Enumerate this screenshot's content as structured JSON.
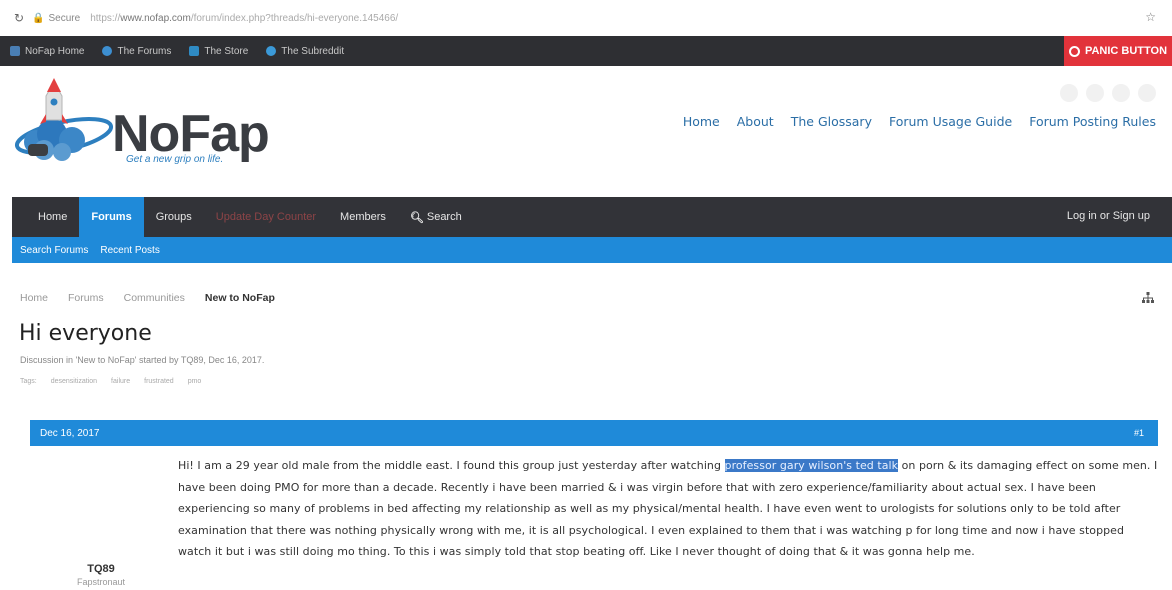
{
  "browser": {
    "secure_label": "Secure",
    "url_prefix": "https://",
    "url_domain": "www.nofap.com",
    "url_path": "/forum/index.php?threads/hi-everyone.145466/"
  },
  "topbar": {
    "links": [
      "NoFap Home",
      "The Forums",
      "The Store",
      "The Subreddit"
    ],
    "panic_label": "PANIC BUTTON"
  },
  "logo": {
    "text": "NoFap",
    "tagline": "Get a new grip on life."
  },
  "header_nav": [
    "Home",
    "About",
    "The Glossary",
    "Forum Usage Guide",
    "Forum Posting Rules"
  ],
  "main_nav": {
    "tabs": [
      "Home",
      "Forums",
      "Groups",
      "Update Day Counter",
      "Members",
      "Search"
    ],
    "login": "Log in or Sign up"
  },
  "sub_nav": [
    "Search Forums",
    "Recent Posts"
  ],
  "breadcrumb": [
    "Home",
    "Forums",
    "Communities",
    "New to NoFap"
  ],
  "thread": {
    "title": "Hi everyone",
    "meta": "Discussion in 'New to NoFap' started by TQ89, Dec 16, 2017.",
    "tags_label": "Tags:",
    "tags": [
      "desensitization",
      "failure",
      "frustrated",
      "pmo"
    ]
  },
  "post": {
    "date": "Dec 16, 2017",
    "number": "#1",
    "text_before": "Hi! I am a 29 year old male from the middle east. I found this group just yesterday after watching ",
    "highlight": "professor gary wilson's ted talk",
    "text_after": " on porn & its damaging effect on some men. I have been doing PMO for more than a decade. Recently i have been married & i was virgin before that with zero experience/familiarity about actual sex. I have been experiencing so many of problems in bed affecting my relationship as well as my physical/mental health. I have even went to urologists for solutions only to be told after examination that there was nothing physically wrong with me, it is all psychological. I even explained to them that i was watching p for long time and now i have stopped watch it but i was still doing mo thing. To this i was simply told that stop beating off. Like I never thought of doing that & it was gonna help me.",
    "author": "TQ89",
    "author_role": "Fapstronaut"
  },
  "colors": {
    "accent": "#1f8ad9",
    "nav_dark": "#323338",
    "panic": "#e2333b"
  }
}
